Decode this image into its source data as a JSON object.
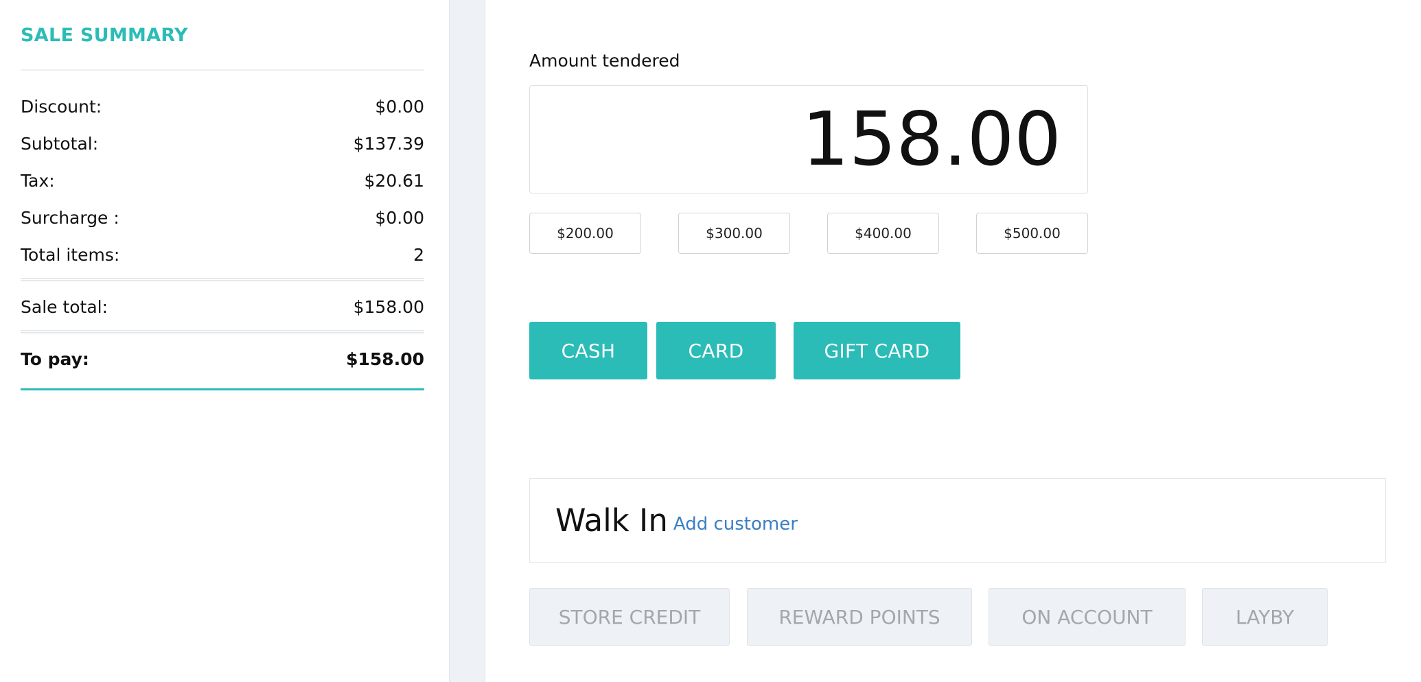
{
  "summary": {
    "title": "SALE SUMMARY",
    "rows": [
      {
        "label": "Discount:",
        "value": "$0.00"
      },
      {
        "label": "Subtotal:",
        "value": "$137.39"
      },
      {
        "label": "Tax:",
        "value": "$20.61"
      },
      {
        "label": "Surcharge :",
        "value": "$0.00"
      },
      {
        "label": "Total items:",
        "value": "2"
      }
    ],
    "sale_total": {
      "label": "Sale total:",
      "value": "$158.00"
    },
    "to_pay": {
      "label": "To pay:",
      "value": "$158.00"
    }
  },
  "payment": {
    "tender_label": "Amount tendered",
    "amount_value": "158.00",
    "quick_amounts": [
      "$200.00",
      "$300.00",
      "$400.00",
      "$500.00"
    ],
    "methods": [
      "CASH",
      "CARD",
      "GIFT CARD"
    ]
  },
  "customer": {
    "name": "Walk In",
    "add_label": "Add customer"
  },
  "alt_methods": [
    "STORE CREDIT",
    "REWARD POINTS",
    "ON ACCOUNT",
    "LAYBY"
  ],
  "colors": {
    "accent": "#2bbcb7",
    "link": "#3a7fc1",
    "disabled_bg": "#eef1f5",
    "disabled_text": "#a3a7ac"
  }
}
